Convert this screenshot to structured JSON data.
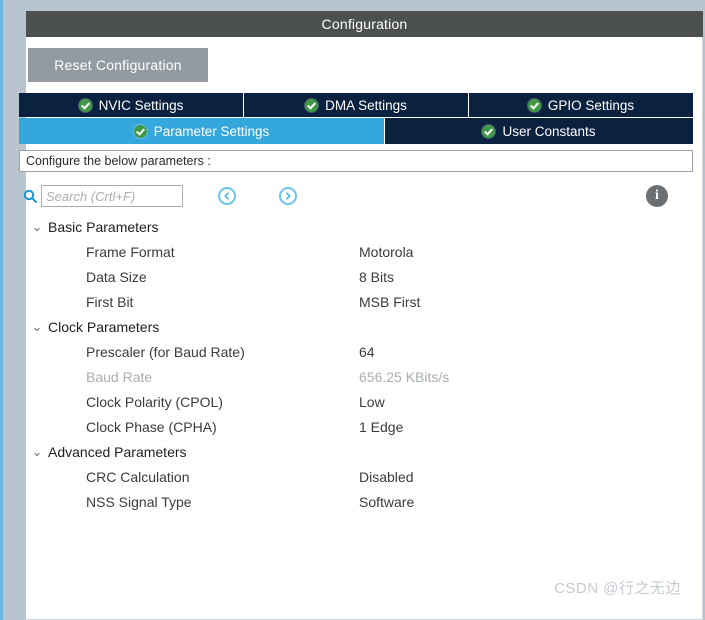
{
  "window": {
    "title": "Configuration"
  },
  "toolbar": {
    "reset_label": "Reset Configuration"
  },
  "tabs": {
    "top_row": [
      {
        "label": "NVIC Settings",
        "icon": "check-badge-icon",
        "active": false
      },
      {
        "label": "DMA Settings",
        "icon": "check-badge-icon",
        "active": false
      },
      {
        "label": "GPIO Settings",
        "icon": "check-badge-icon",
        "active": false
      }
    ],
    "bottom_row": [
      {
        "label": "Parameter Settings",
        "icon": "check-badge-icon",
        "active": true
      },
      {
        "label": "User Constants",
        "icon": "check-badge-icon",
        "active": false
      }
    ]
  },
  "instruction": {
    "text": "Configure the below parameters :"
  },
  "search": {
    "placeholder": "Search (Crtl+F)",
    "value": "",
    "icon": "search-icon",
    "prev_icon": "chevron-left-circle-icon",
    "next_icon": "chevron-right-circle-icon",
    "info_icon": "info-icon",
    "info_glyph": "i"
  },
  "parameters": {
    "chevron_glyph": "⌄",
    "groups": [
      {
        "label": "Basic Parameters",
        "expanded": true,
        "rows": [
          {
            "name": "Frame Format",
            "value": "Motorola",
            "disabled": false
          },
          {
            "name": "Data Size",
            "value": "8 Bits",
            "disabled": false
          },
          {
            "name": "First Bit",
            "value": "MSB First",
            "disabled": false
          }
        ]
      },
      {
        "label": "Clock Parameters",
        "expanded": true,
        "rows": [
          {
            "name": "Prescaler (for Baud Rate)",
            "value": "64",
            "disabled": false
          },
          {
            "name": "Baud Rate",
            "value": "656.25 KBits/s",
            "disabled": true
          },
          {
            "name": "Clock Polarity (CPOL)",
            "value": "Low",
            "disabled": false
          },
          {
            "name": "Clock Phase (CPHA)",
            "value": "1 Edge",
            "disabled": false
          }
        ]
      },
      {
        "label": "Advanced Parameters",
        "expanded": true,
        "rows": [
          {
            "name": "CRC Calculation",
            "value": "Disabled",
            "disabled": false
          },
          {
            "name": "NSS Signal Type",
            "value": "Software",
            "disabled": false
          }
        ]
      }
    ]
  },
  "watermark": {
    "text": "CSDN @行之无边"
  },
  "colors": {
    "titlebar": "#4d5051",
    "frame": "#b9c5ce",
    "tab_inactive": "#0a2240",
    "tab_active": "#34a8dd",
    "accent_blue": "#6fb5e0",
    "check_green": "#3f9a45",
    "button_grey": "#939ba2"
  }
}
